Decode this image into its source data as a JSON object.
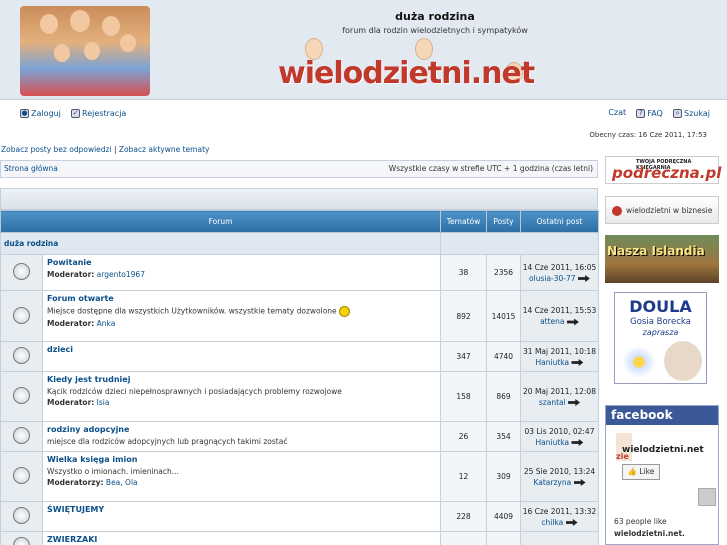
{
  "header": {
    "title": "duża rodzina",
    "description": "forum dla rodzin wielodzietnych i sympatyków",
    "logo_text": "wielodzietni.net"
  },
  "nav": {
    "login": "Zaloguj",
    "register": "Rejestracja",
    "chat": "Czat",
    "faq": "FAQ",
    "search": "Szukaj"
  },
  "current_time": "Obecny czas: 16 Cze 2011, 17:53",
  "links": {
    "unanswered": "Zobacz posty bez odpowiedzi",
    "separator": "|",
    "active": "Zobacz aktywne tematy"
  },
  "breadcrumb": {
    "home": "Strona główna",
    "timezone": "Wszystkie czasy w strefie UTC + 1 godzina (czas letni)"
  },
  "table": {
    "headers": {
      "forum": "Forum",
      "topics": "Tematów",
      "posts": "Posty",
      "last_post": "Ostatni post"
    },
    "category": "duża rodzina",
    "moderator_label": "Moderator:",
    "moderators_label": "Moderatorzy:",
    "forums": [
      {
        "name": "Powitanie",
        "desc": "",
        "moderator": "argento1967",
        "mod_label": "Moderator:",
        "topics": "38",
        "posts": "2356",
        "last_date": "14 Cze 2011, 16:05",
        "last_user": "olusia-30-77"
      },
      {
        "name": "Forum otwarte",
        "desc": "Miejsce dostępne dla wszystkich Użytkowników. wszystkie tematy dozwolone",
        "moderator": "Anka",
        "mod_label": "Moderator:",
        "topics": "892",
        "posts": "14015",
        "last_date": "14 Cze 2011, 15:53",
        "last_user": "attena"
      },
      {
        "name": "dzieci",
        "desc": "",
        "moderator": "",
        "mod_label": "",
        "topics": "347",
        "posts": "4740",
        "last_date": "31 Maj 2011, 10:18",
        "last_user": "Haniutka"
      },
      {
        "name": "Kiedy jest trudniej",
        "desc": "Kącik rodziców dzieci niepełnosprawnych i posiadających problemy rozwojowe",
        "moderator": "Isia",
        "mod_label": "Moderator:",
        "topics": "158",
        "posts": "869",
        "last_date": "20 Maj 2011, 12:08",
        "last_user": "szantal"
      },
      {
        "name": "rodziny adopcyjne",
        "desc": "miejsce dla rodziców adopcyjnych lub pragnących takimi zostać",
        "moderator": "",
        "mod_label": "",
        "topics": "26",
        "posts": "354",
        "last_date": "03 Lis 2010, 02:47",
        "last_user": "Haniutka"
      },
      {
        "name": "Wielka księga imion",
        "desc": "Wszystko o imionach. imieninach...",
        "moderator": "Bea, Ola",
        "mod_label": "Moderatorzy:",
        "topics": "12",
        "posts": "309",
        "last_date": "25 Sie 2010, 13:24",
        "last_user": "Katarzyna"
      },
      {
        "name": "ŚWIĘTUJEMY",
        "desc": "",
        "moderator": "",
        "mod_label": "",
        "topics": "228",
        "posts": "4409",
        "last_date": "16 Cze 2011, 13:32",
        "last_user": "chilka"
      },
      {
        "name": "ZWIERZAKI",
        "desc": "",
        "moderator": "",
        "mod_label": "",
        "topics": "",
        "posts": "",
        "last_date": "",
        "last_user": ""
      }
    ]
  },
  "sidebar": {
    "ad1_small": "TWOJA PODRĘCZNA KSIĘGARNIA",
    "ad1_main": "podreczna.pl",
    "ad2": "wielodzietni w biznesie",
    "ad3": "Nasza Islandia",
    "ad4_title": "DOULA",
    "ad4_name": "Gosia Borecka",
    "ad4_sub": "zaprasza",
    "facebook": {
      "brand": "facebook",
      "page_name": "wielodzietni.net",
      "like": "Like",
      "count_text": "63 people like",
      "count_page": "wielodzietni.net."
    }
  }
}
